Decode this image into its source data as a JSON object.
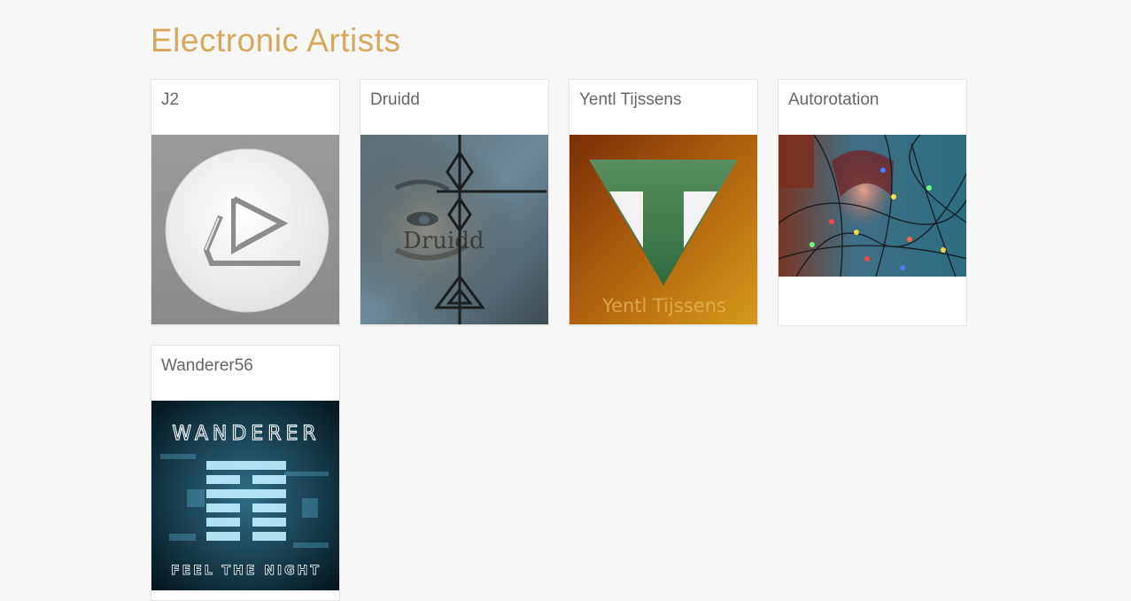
{
  "page": {
    "title": "Electronic Artists"
  },
  "colors": {
    "title": "#d6a85c",
    "background": "#f7f7f7",
    "card_text": "#666666"
  },
  "artists": [
    {
      "name": "J2",
      "artwork": "j2-logo-artwork"
    },
    {
      "name": "Druidd",
      "artwork": "druidd-portrait-artwork"
    },
    {
      "name": "Yentl Tijssens",
      "artwork": "yentl-triangle-logo-artwork",
      "artwork_text": "Yentl Tijssens"
    },
    {
      "name": "Autorotation",
      "artwork": "autorotation-lights-photo"
    },
    {
      "name": "Wanderer56",
      "artwork": "wanderer-album-artwork",
      "artwork_text_top": "WANDERER",
      "artwork_text_bottom": "FEEL THE NIGHT"
    }
  ]
}
